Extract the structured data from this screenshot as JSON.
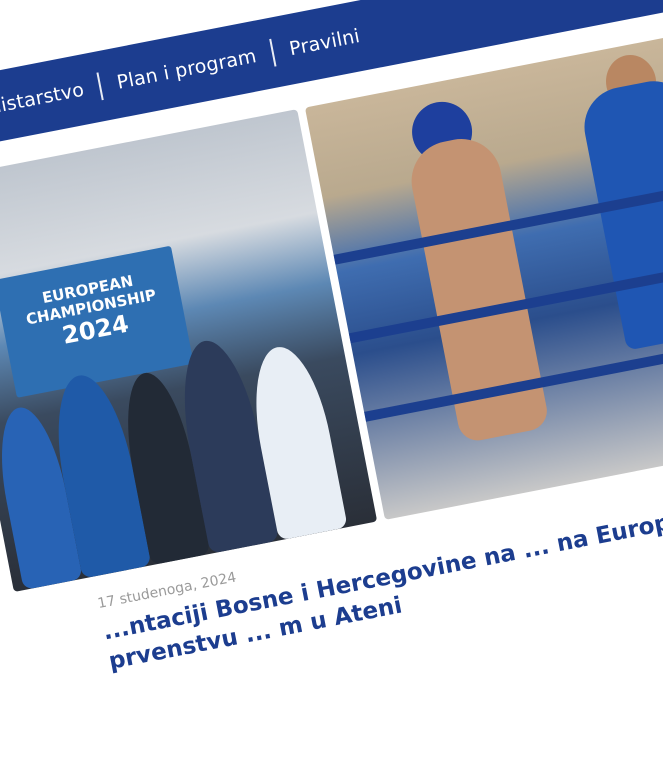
{
  "nav": {
    "items": [
      {
        "label": "Ministarstvo"
      },
      {
        "label": "Plan i program"
      },
      {
        "label": "Pravilni"
      }
    ]
  },
  "photos": {
    "left_banner_line1": "EUROPEAN",
    "left_banner_line2": "CHAMPIONSHIP",
    "left_banner_year": "2024"
  },
  "article": {
    "date": "17 studenoga, 2024",
    "title": "...ntaciji Bosne i Hercegovine na ... na Europskom prvenstvu ... m u Ateni"
  },
  "colors": {
    "brand": "#1c3d8f"
  }
}
